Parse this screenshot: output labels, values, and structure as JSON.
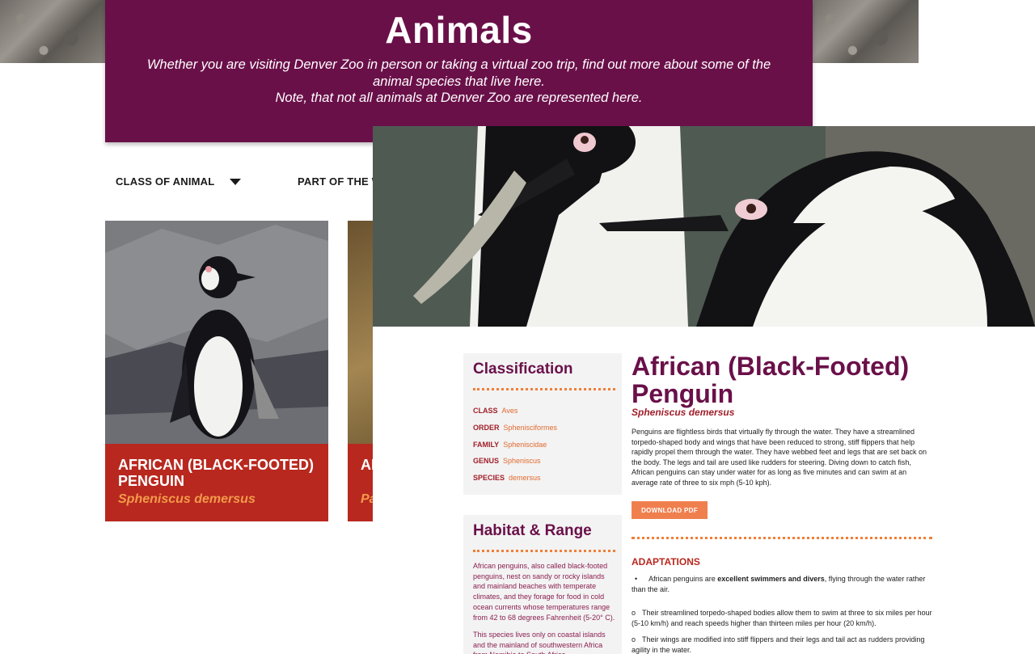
{
  "header": {
    "title": "Animals",
    "subtitle_line1": "Whether you are visiting Denver Zoo in person or taking a virtual zoo trip, find out more about some of the",
    "subtitle_line2": "animal species that live here.",
    "subtitle_line3": "Note, that not all animals at Denver Zoo are represented here."
  },
  "filters": [
    {
      "label": "CLASS OF ANIMAL"
    },
    {
      "label": "PART OF THE W"
    }
  ],
  "cards": [
    {
      "name": "AFRICAN (BLACK-FOOTED) PENGUIN",
      "scientific": "Spheniscus demersus"
    },
    {
      "name": "AF",
      "scientific": "Pa"
    }
  ],
  "detail": {
    "classification": {
      "heading": "Classification",
      "rows": [
        {
          "label": "CLASS",
          "value": "Aves"
        },
        {
          "label": "ORDER",
          "value": "Sphenisciformes"
        },
        {
          "label": "FAMILY",
          "value": "Spheniscidae"
        },
        {
          "label": "GENUS",
          "value": "Spheniscus"
        },
        {
          "label": "SPECIES",
          "value": "demersus"
        }
      ]
    },
    "habitat": {
      "heading": "Habitat & Range",
      "para1": "African penguins, also called black-footed penguins, nest on sandy or rocky islands and mainland beaches with temperate climates, and they forage for food in cold ocean currents whose temperatures range from 42 to 68 degrees Fahrenheit (5-20° C).",
      "para2": "This species lives only on coastal islands and the mainland of southwestern Africa from Namibia to South Africa."
    },
    "title": "African (Black-Footed) Penguin",
    "scientific": "Spheniscus demersus",
    "description": "Penguins are flightless birds that virtually fly through the water. They have a streamlined torpedo-shaped body and wings that have been reduced to strong, stiff flippers that help rapidly propel them through the water. They have webbed feet and legs that are set back on the body. The legs and tail are used like rudders for steering. Diving down to catch fish, African penguins can stay under water for as long as five minutes and can swim at an average rate of three to six mph (5-10 kph).",
    "download_label": "DOWNLOAD PDF",
    "adaptations_heading": "ADAPTATIONS",
    "adaptations": {
      "a1_bullet": "•",
      "a1_pre": "African penguins are ",
      "a1_bold": "excellent swimmers and divers",
      "a1_post": ", flying through the water rather than the air.",
      "a2_marker": "o",
      "a2_text": "Their streamlined torpedo-shaped bodies allow them to swim at three to six miles per hour (5-10 km/h) and reach speeds higher than thirteen miles per hour (20 km/h).",
      "a3_marker": "o",
      "a3_text": "Their wings are modified into stiff flippers and their legs and tail act as rudders providing agility in the water."
    }
  },
  "colors": {
    "header_bg": "#6a1049",
    "card_caption_bg": "#b8281f",
    "accent_orange": "#f07f37",
    "scientific_red": "#a01f2a"
  },
  "icons": {
    "filter_caret": "caret-down-icon"
  }
}
